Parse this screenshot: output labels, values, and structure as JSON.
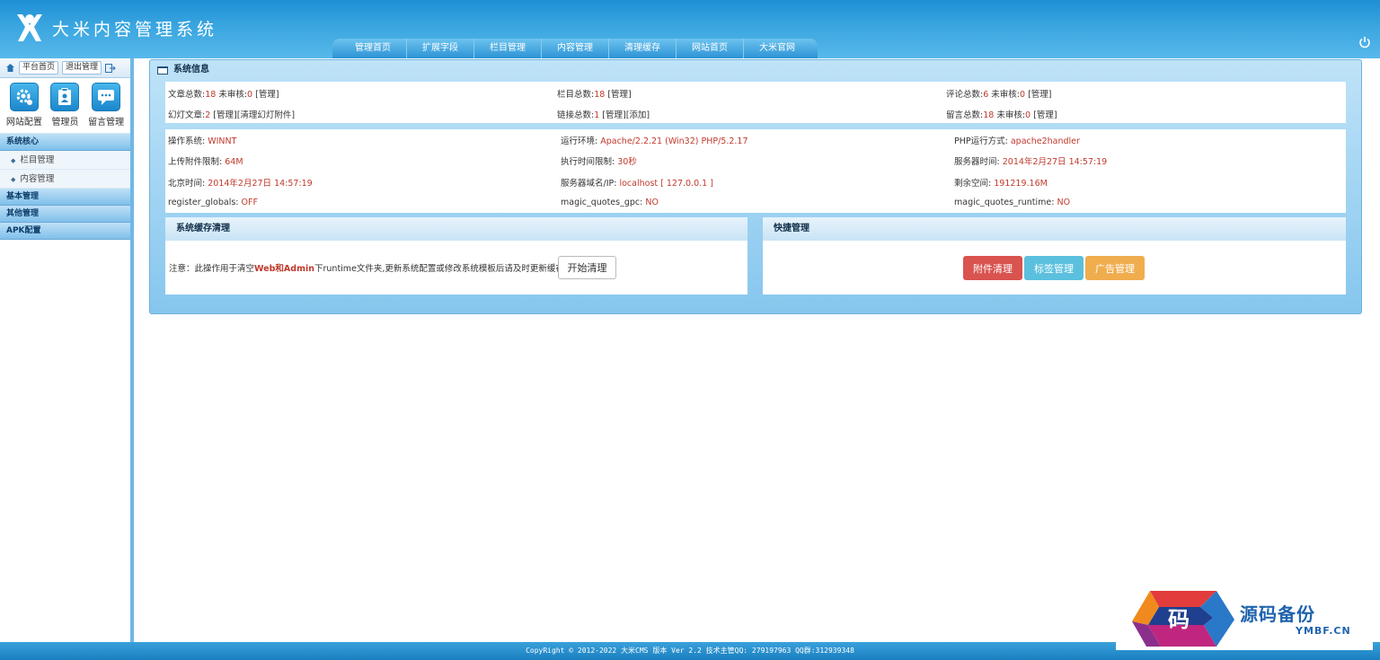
{
  "header": {
    "title": "大米内容管理系统",
    "nav": [
      "管理首页",
      "扩展字段",
      "栏目管理",
      "内容管理",
      "清理缓存",
      "网站首页",
      "大米官网"
    ]
  },
  "sidebar": {
    "top_buttons": [
      "平台首页",
      "退出管理"
    ],
    "quick_icons": [
      {
        "label": "网站配置",
        "icon": "gear-icon"
      },
      {
        "label": "管理员",
        "icon": "clipboard-icon"
      },
      {
        "label": "留言管理",
        "icon": "chat-icon"
      }
    ],
    "sections": [
      {
        "title": "系统核心",
        "items": [
          "栏目管理",
          "内容管理"
        ]
      },
      {
        "title": "基本管理",
        "items": []
      },
      {
        "title": "其他管理",
        "items": []
      },
      {
        "title": "APK配置",
        "items": []
      }
    ]
  },
  "panel": {
    "title": "系统信息",
    "stats": {
      "articles": {
        "label": "文章总数:",
        "count": "18",
        "pending_label": "未审核:",
        "pending": "0",
        "links": "[管理]"
      },
      "slides": {
        "label": "幻灯文章:",
        "count": "2",
        "links": "[管理][清理幻灯附件]"
      },
      "columns": {
        "label": "栏目总数:",
        "count": "18",
        "links": "[管理]"
      },
      "friendlinks": {
        "label": "链接总数:",
        "count": "1",
        "links": "[管理][添加]"
      },
      "comments": {
        "label": "评论总数:",
        "count": "6",
        "pending_label": "未审核:",
        "pending": "0",
        "links": "[管理]"
      },
      "messages": {
        "label": "留言总数:",
        "count": "18",
        "pending_label": "未审核:",
        "pending": "0",
        "links": "[管理]"
      }
    },
    "env": [
      {
        "label": "操作系统:",
        "value": "WINNT"
      },
      {
        "label": "运行环境:",
        "value": "Apache/2.2.21 (Win32) PHP/5.2.17"
      },
      {
        "label": "PHP运行方式:",
        "value": "apache2handler"
      },
      {
        "label": "上传附件限制:",
        "value": "64M"
      },
      {
        "label": "执行时间限制:",
        "value": "30秒"
      },
      {
        "label": "服务器时间:",
        "value": "2014年2月27日 14:57:19"
      },
      {
        "label": "北京时间:",
        "value": "2014年2月27日 14:57:19"
      },
      {
        "label": "服务器域名/IP:",
        "value": "localhost [ 127.0.0.1 ]"
      },
      {
        "label": "剩余空间:",
        "value": "191219.16M"
      },
      {
        "label": "register_globals:",
        "value": "OFF"
      },
      {
        "label": "magic_quotes_gpc:",
        "value": "NO"
      },
      {
        "label": "magic_quotes_runtime:",
        "value": "NO"
      }
    ]
  },
  "cache": {
    "title": "系统缓存清理",
    "note_pre": "注意：此操作用于清空",
    "note_web": "Web",
    "note_and": "和",
    "note_admin": "Admin",
    "note_post": "下runtime文件夹,更新系统配置或修改系统模板后请及时更新缓存",
    "button": "开始清理"
  },
  "quick": {
    "title": "快捷管理",
    "buttons": [
      {
        "label": "附件清理",
        "color": "#d9534f"
      },
      {
        "label": "标签管理",
        "color": "#5bc0de"
      },
      {
        "label": "广告管理",
        "color": "#f0ad4e"
      }
    ]
  },
  "footer": {
    "text": "CopyRight © 2012-2022 大米CMS 版本 Ver 2.2 技术主管QQ: 279197963 QQ群:312939348"
  },
  "watermark": {
    "brand": "源码备份",
    "site": "YMBF.CN",
    "char": "码"
  }
}
